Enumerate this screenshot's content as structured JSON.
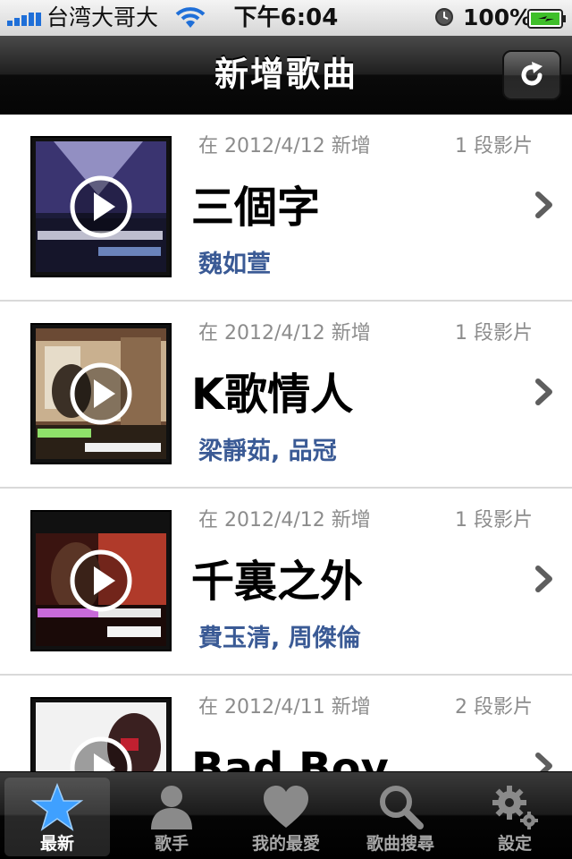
{
  "status_bar": {
    "carrier": "台湾大哥大",
    "time": "下午6:04",
    "battery_percent": "100%"
  },
  "nav": {
    "title": "新增歌曲",
    "refresh_icon": "refresh-icon"
  },
  "songs": [
    {
      "date": "在 2012/4/12 新增",
      "videos": "1 段影片",
      "title": "三個字",
      "artist": "魏如萱"
    },
    {
      "date": "在 2012/4/12 新增",
      "videos": "1 段影片",
      "title": "K歌情人",
      "artist": "梁靜茹, 品冠"
    },
    {
      "date": "在 2012/4/12 新增",
      "videos": "1 段影片",
      "title": "千裏之外",
      "artist": "費玉清, 周傑倫"
    },
    {
      "date": "在 2012/4/11 新增",
      "videos": "2 段影片",
      "title": "Bad Boy",
      "artist": ""
    }
  ],
  "tabs": [
    {
      "label": "最新",
      "icon": "star-icon",
      "active": true
    },
    {
      "label": "歌手",
      "icon": "person-icon",
      "active": false
    },
    {
      "label": "我的最愛",
      "icon": "heart-icon",
      "active": false
    },
    {
      "label": "歌曲搜尋",
      "icon": "magnifier-icon",
      "active": false
    },
    {
      "label": "設定",
      "icon": "gear-icon",
      "active": false
    }
  ],
  "colors": {
    "artist_text": "#3a5a95",
    "active_tab_icon": "#3fa0ff",
    "signal_bars": "#1f6fd8",
    "battery_fill": "#3fbf2a"
  }
}
